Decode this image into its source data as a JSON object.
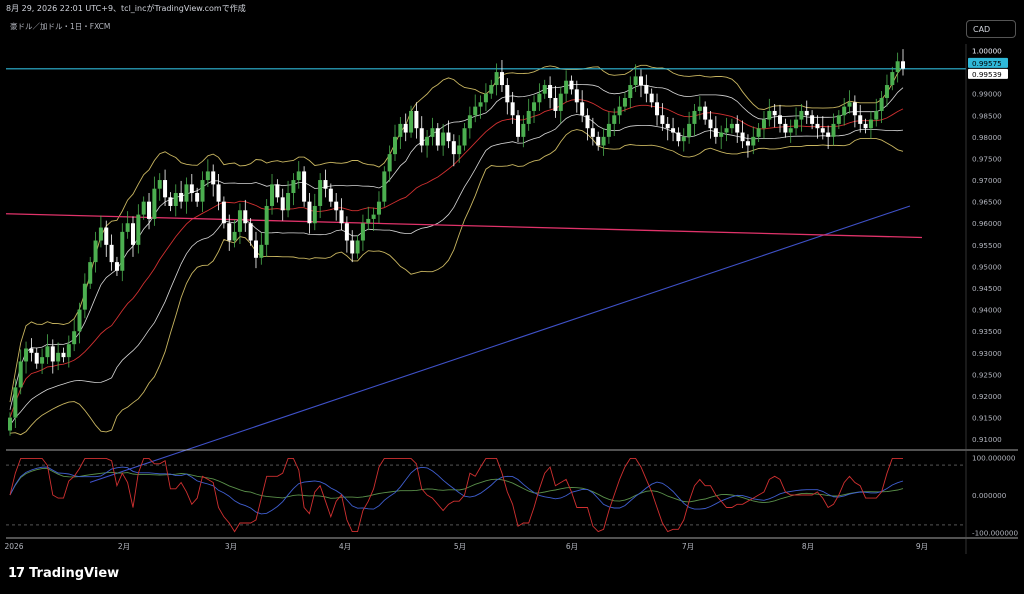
{
  "header": {
    "timestamp": "8月 29, 2026 22:01 UTC+9、tcl_incがTradingView.comで作成",
    "symbol": "豪ドル／加ドル・1日・FXCM",
    "currency": "CAD"
  },
  "footer": {
    "logo_text": "TradingView",
    "logo_mark": "17"
  },
  "colors": {
    "background": "#000000",
    "candle_up": "#4caf50",
    "candle_down": "#ffffff",
    "bb_outer": "#c8b560",
    "bb_inner": "#d8d8d8",
    "ma_mid": "#d03030",
    "ma_long": "#3f51c8",
    "trendline": "#e0336a",
    "hline": "#2fb8d8",
    "rsi_red": "#d03030",
    "stoch_blue": "#3f5ecf",
    "stoch_green": "#5a8f4a"
  },
  "chart_data": [
    {
      "type": "candlestick",
      "title": "",
      "y_ticks": [
        "1.00000",
        "0.99000",
        "0.98500",
        "0.98000",
        "0.97500",
        "0.97000",
        "0.96500",
        "0.96000",
        "0.95500",
        "0.95000",
        "0.94500",
        "0.94000",
        "0.93500",
        "0.93000",
        "0.92500",
        "0.92000",
        "0.91500",
        "0.91000"
      ],
      "ylim": [
        0.9075,
        1.0015
      ],
      "x_ticks": [
        "2026",
        "2月",
        "3月",
        "4月",
        "5月",
        "6月",
        "7月",
        "8月",
        "9月"
      ],
      "price_labels": {
        "current": "0.99575",
        "line": "0.99539",
        "top": "1.00000"
      },
      "horizontal_line": 0.99575,
      "closes": [
        0.915,
        0.922,
        0.928,
        0.931,
        0.93,
        0.9275,
        0.929,
        0.9315,
        0.928,
        0.93,
        0.929,
        0.932,
        0.935,
        0.94,
        0.946,
        0.951,
        0.956,
        0.959,
        0.955,
        0.951,
        0.949,
        0.958,
        0.96,
        0.955,
        0.962,
        0.965,
        0.961,
        0.968,
        0.97,
        0.966,
        0.964,
        0.967,
        0.965,
        0.969,
        0.967,
        0.965,
        0.97,
        0.972,
        0.969,
        0.965,
        0.96,
        0.956,
        0.958,
        0.963,
        0.96,
        0.956,
        0.952,
        0.955,
        0.964,
        0.969,
        0.966,
        0.963,
        0.967,
        0.97,
        0.972,
        0.965,
        0.96,
        0.964,
        0.97,
        0.968,
        0.965,
        0.963,
        0.96,
        0.956,
        0.953,
        0.956,
        0.96,
        0.961,
        0.962,
        0.965,
        0.972,
        0.976,
        0.98,
        0.983,
        0.981,
        0.986,
        0.982,
        0.978,
        0.98,
        0.982,
        0.978,
        0.981,
        0.979,
        0.976,
        0.978,
        0.982,
        0.985,
        0.987,
        0.988,
        0.99,
        0.992,
        0.995,
        0.992,
        0.988,
        0.985,
        0.98,
        0.983,
        0.986,
        0.988,
        0.99,
        0.992,
        0.989,
        0.986,
        0.99,
        0.993,
        0.991,
        0.988,
        0.985,
        0.982,
        0.98,
        0.978,
        0.98,
        0.983,
        0.985,
        0.987,
        0.989,
        0.992,
        0.994,
        0.992,
        0.99,
        0.988,
        0.985,
        0.983,
        0.982,
        0.981,
        0.979,
        0.98,
        0.983,
        0.986,
        0.987,
        0.984,
        0.982,
        0.98,
        0.981,
        0.982,
        0.983,
        0.981,
        0.979,
        0.978,
        0.98,
        0.982,
        0.984,
        0.986,
        0.985,
        0.983,
        0.981,
        0.982,
        0.984,
        0.986,
        0.985,
        0.983,
        0.982,
        0.981,
        0.98,
        0.983,
        0.985,
        0.987,
        0.988,
        0.985,
        0.983,
        0.982,
        0.984,
        0.986,
        0.989,
        0.992,
        0.995,
        0.9975,
        0.9958
      ],
      "ma_long": {
        "start": 0.9,
        "end": 0.964
      },
      "trendline": {
        "start": 0.9622,
        "end": 0.9567
      },
      "bb_period": 20,
      "ma_mid_period": 20
    },
    {
      "type": "line",
      "title": "",
      "y_ticks": [
        "100.000000",
        "0.000000",
        "-100.000000"
      ],
      "ylim": [
        -115,
        115
      ],
      "series": [
        {
          "key": "rsi_red"
        },
        {
          "key": "stoch_blue"
        },
        {
          "key": "stoch_green"
        }
      ]
    }
  ]
}
